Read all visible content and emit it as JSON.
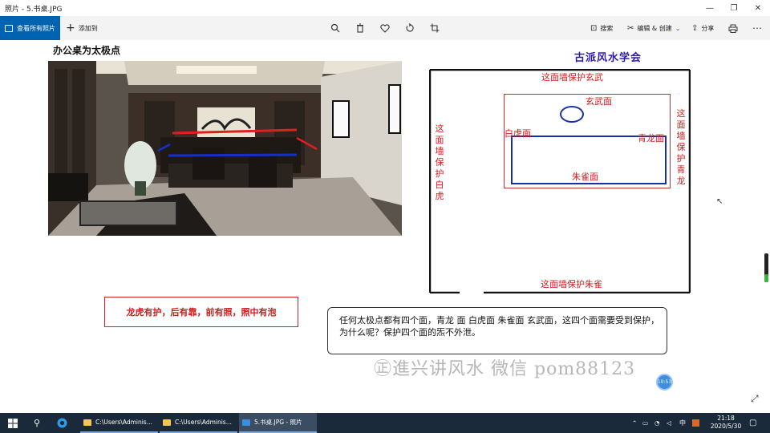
{
  "window": {
    "title": "照片 - 5.书桌.JPG"
  },
  "toolbar": {
    "view_all_label": "查看所有照片",
    "add_to_label": "添加到",
    "search_label": "搜索",
    "edit_create_label": "编辑 & 创建",
    "share_label": "分享"
  },
  "doc": {
    "heading": "办公桌为太极点",
    "association": "古派风水学会",
    "top_wall": "这面墙保护玄武",
    "bottom_wall": "这面墙保护朱雀",
    "left_wall": "这面墙保护白虎",
    "right_wall": "这面墙保护青龙",
    "xuanwu": "玄武面",
    "baihu": "白虎面",
    "qinglong": "青龙面",
    "zhuque": "朱雀面",
    "note_left": "龙虎有护，后有靠，前有照，照中有泡",
    "note_right": "任何太极点都有四个面，青龙 面 白虎面 朱雀面 玄武面，这四个面需要受到保护，为什么呢？保护四个面的炁不外泄。",
    "watermark": "㊣進兴讲风水 微信 pom88123"
  },
  "overlay": {
    "time_badge": "10:53"
  },
  "taskbar": {
    "apps": [
      {
        "label": "C:\\Users\\Adminis..."
      },
      {
        "label": "C:\\Users\\Adminis..."
      },
      {
        "label": "5.书桌.JPG - 照片"
      }
    ],
    "ime": "中",
    "time": "21:18",
    "date": "2020/5/30"
  },
  "colors": {
    "accent": "#0063b1",
    "red_text": "#d01c1c",
    "blue_line": "#1730a8",
    "association": "#2d1ab0",
    "taskbar": "#1b2a3a"
  }
}
